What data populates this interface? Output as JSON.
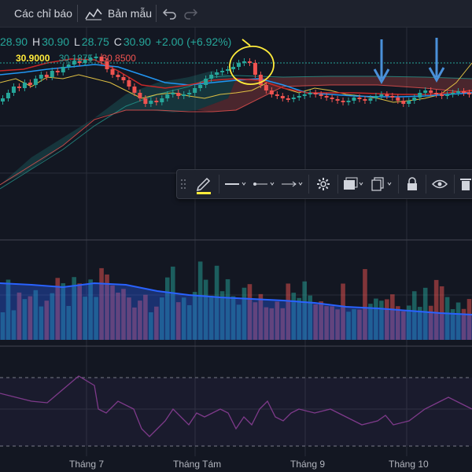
{
  "topbar": {
    "indicators_label": "Các chỉ báo",
    "templates_label": "Bản mẫu"
  },
  "ohlc": {
    "open_value": "28.90",
    "high_label": "H",
    "high_value": "30.90",
    "low_label": "L",
    "low_value": "28.75",
    "close_label": "C",
    "close_value": "30.90",
    "change": "+2.00 (+6.92%)"
  },
  "indicator_row": {
    "value_yellow": "30.9000",
    "value_green": "30.1875",
    "value_red": "30.8500"
  },
  "x_axis": {
    "labels": [
      "Tháng 7",
      "Tháng Tám",
      "Tháng 9",
      "Tháng 10"
    ]
  },
  "drawing_toolbar": {
    "icons": [
      "drag-handle-icon",
      "pencil-icon",
      "line-style-icon",
      "line-width-icon",
      "line-end-icon",
      "gear-icon",
      "fill-icon",
      "clone-icon",
      "lock-icon",
      "eye-icon",
      "trash-icon"
    ]
  },
  "colors": {
    "background": "#131722",
    "up": "#26a69a",
    "down": "#ef5350",
    "accent_yellow": "#ffeb3b",
    "volume_ma": "#2962ff",
    "rsi": "#7e3a8a",
    "arrow": "#4a90d9"
  }
}
